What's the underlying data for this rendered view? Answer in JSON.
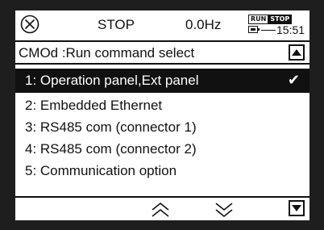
{
  "status": {
    "state": "STOP",
    "frequency": "0.0Hz",
    "mode_run": "RUN",
    "mode_stop": "STOP",
    "time": "15:51"
  },
  "header": {
    "title": "CMOd :Run command select"
  },
  "options": [
    {
      "label": "1: Operation panel,Ext panel",
      "check": "✔"
    },
    {
      "label": "2: Embedded Ethernet"
    },
    {
      "label": "3: RS485 com (connector 1)"
    },
    {
      "label": "4: RS485 com (connector 2)"
    },
    {
      "label": "5: Communication option"
    }
  ],
  "icons": {
    "status": "circle-x-icon",
    "battery": "battery-icon",
    "scroll_up": "triangle-up-icon",
    "scroll_down": "triangle-down-icon",
    "page_up": "double-chevron-up-icon",
    "page_down": "double-chevron-down-icon"
  },
  "colors": {
    "background": "#1e1e1e",
    "screen": "#ffffff",
    "ink": "#111111"
  }
}
